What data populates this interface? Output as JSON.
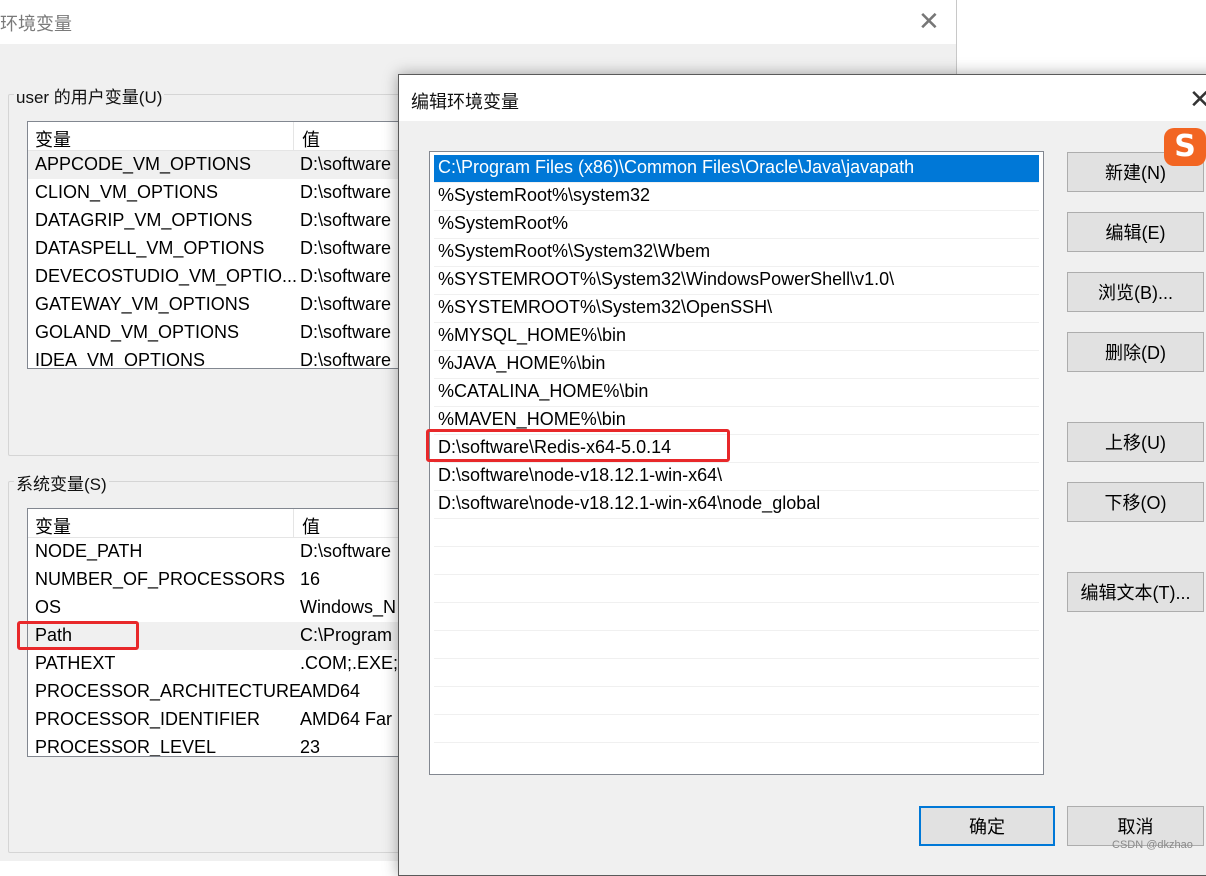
{
  "background_window": {
    "title": "环境变量",
    "close_symbol": "✕",
    "user_vars": {
      "group_label": "user 的用户变量(U)",
      "columns": [
        "变量",
        "值"
      ],
      "rows": [
        [
          "APPCODE_VM_OPTIONS",
          "D:\\software"
        ],
        [
          "CLION_VM_OPTIONS",
          "D:\\software"
        ],
        [
          "DATAGRIP_VM_OPTIONS",
          "D:\\software"
        ],
        [
          "DATASPELL_VM_OPTIONS",
          "D:\\software"
        ],
        [
          "DEVECOSTUDIO_VM_OPTIO...",
          "D:\\software"
        ],
        [
          "GATEWAY_VM_OPTIONS",
          "D:\\software"
        ],
        [
          "GOLAND_VM_OPTIONS",
          "D:\\software"
        ],
        [
          "IDEA_VM_OPTIONS",
          "D:\\software"
        ]
      ]
    },
    "system_vars": {
      "group_label": "系统变量(S)",
      "columns": [
        "变量",
        "值"
      ],
      "rows": [
        [
          "NODE_PATH",
          "D:\\software"
        ],
        [
          "NUMBER_OF_PROCESSORS",
          "16"
        ],
        [
          "OS",
          "Windows_N"
        ],
        [
          "Path",
          "C:\\Program"
        ],
        [
          "PATHEXT",
          ".COM;.EXE;."
        ],
        [
          "PROCESSOR_ARCHITECTURE",
          "AMD64"
        ],
        [
          "PROCESSOR_IDENTIFIER",
          "AMD64 Far"
        ],
        [
          "PROCESSOR_LEVEL",
          "23"
        ]
      ]
    }
  },
  "dialog": {
    "title": "编辑环境变量",
    "close_symbol": "✕",
    "paths": [
      "C:\\Program Files (x86)\\Common Files\\Oracle\\Java\\javapath",
      "%SystemRoot%\\system32",
      "%SystemRoot%",
      "%SystemRoot%\\System32\\Wbem",
      "%SYSTEMROOT%\\System32\\WindowsPowerShell\\v1.0\\",
      "%SYSTEMROOT%\\System32\\OpenSSH\\",
      "%MYSQL_HOME%\\bin",
      "%JAVA_HOME%\\bin",
      "%CATALINA_HOME%\\bin",
      "%MAVEN_HOME%\\bin",
      "D:\\software\\Redis-x64-5.0.14",
      "D:\\software\\node-v18.12.1-win-x64\\",
      "D:\\software\\node-v18.12.1-win-x64\\node_global"
    ],
    "buttons": {
      "new": "新建(N)",
      "edit": "编辑(E)",
      "browse": "浏览(B)...",
      "delete": "删除(D)",
      "move_up": "上移(U)",
      "move_down": "下移(O)",
      "edit_text": "编辑文本(T)...",
      "ok": "确定",
      "cancel": "取消"
    }
  },
  "ime_icon": {
    "glyph": "S",
    "color": "#f26522"
  },
  "watermark": "CSDN @dkzhao",
  "colors": {
    "selection": "#0078d7",
    "highlight_box": "#e8282a"
  }
}
